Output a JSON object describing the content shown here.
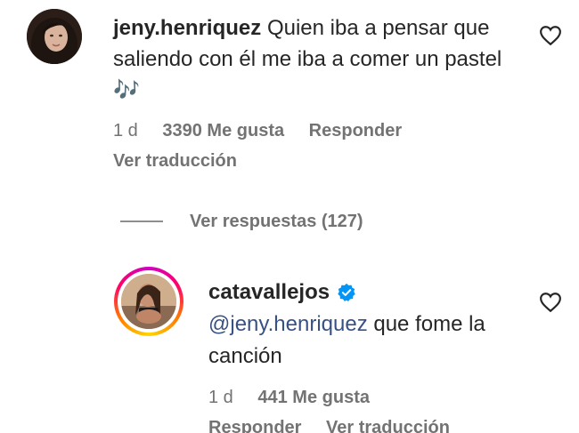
{
  "comment": {
    "username": "jeny.henriquez",
    "text": "Quien iba a pensar que saliendo con él me iba a comer un pastel",
    "emoji": "🎶",
    "time": "1 d",
    "likes": "3390 Me gusta",
    "reply_label": "Responder",
    "translate_label": "Ver traducción"
  },
  "view_replies": {
    "label": "Ver respuestas (127)"
  },
  "reply": {
    "username": "catavallejos",
    "mention": "@jeny.henriquez",
    "text": "que fome la canción",
    "time": "1 d",
    "likes": "441 Me gusta",
    "reply_label": "Responder",
    "translate_label": "Ver traducción"
  },
  "colors": {
    "text": "#262626",
    "muted": "#737373",
    "mention": "#385185",
    "verified": "#0095f6"
  },
  "icons": {
    "like": "heart-outline-icon",
    "verified": "verified-badge-icon"
  }
}
